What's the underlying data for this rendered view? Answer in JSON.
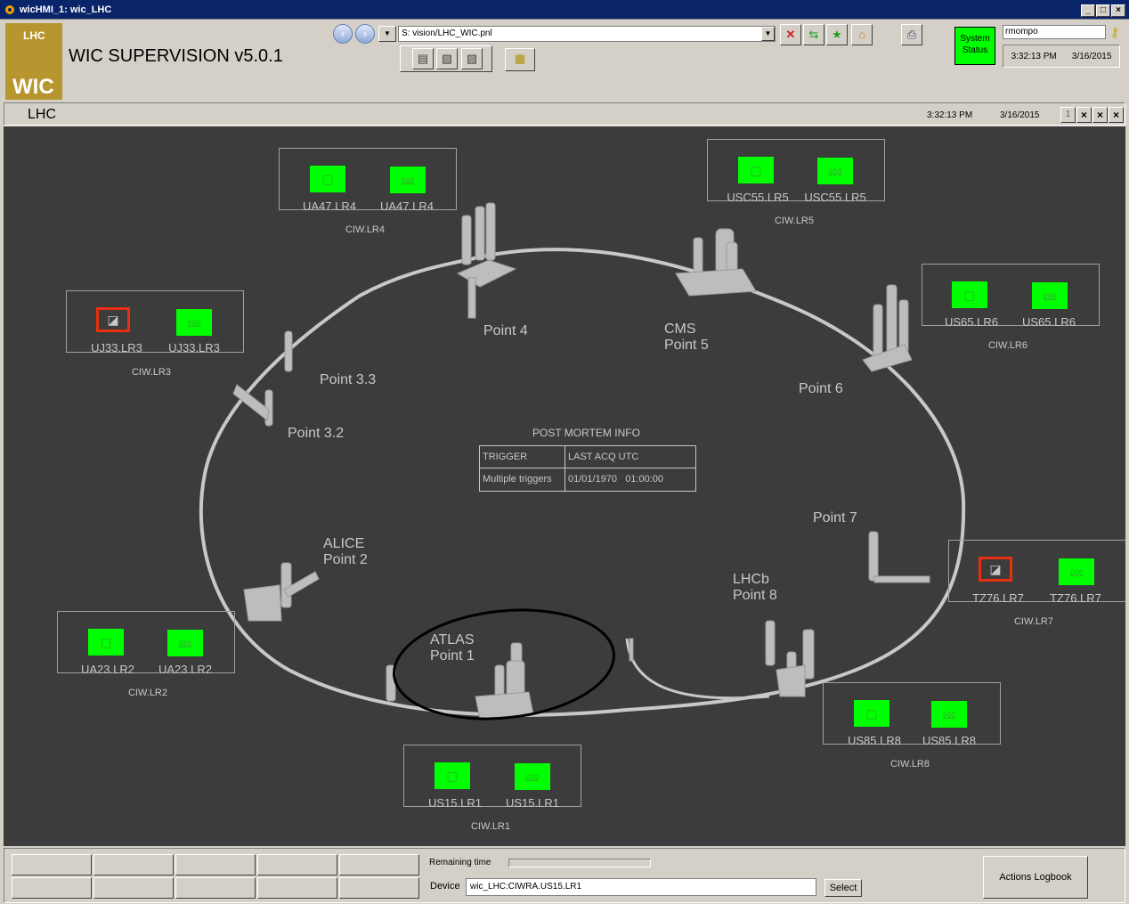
{
  "window": {
    "title": "wicHMI_1: wic_LHC"
  },
  "app": {
    "logo_top": "LHC",
    "logo_bottom": "WIC",
    "title": "WIC SUPERVISION v5.0.1"
  },
  "toolbar": {
    "path": "S: vision/LHC_WIC.pnl"
  },
  "status": {
    "system_status": "System Status",
    "user": "rmompo",
    "time": "3:32:13 PM",
    "date": "3/16/2015"
  },
  "panel": {
    "name": "LHC",
    "time": "3:32:13 PM",
    "date": "3/16/2015",
    "page": "1"
  },
  "sectors": [
    {
      "cab1": "UA47.LR4",
      "cab2": "UA47.LR4",
      "ciw": "CIW.LR4",
      "fault1": false
    },
    {
      "cab1": "USC55.LR5",
      "cab2": "USC55.LR5",
      "ciw": "CIW.LR5",
      "fault1": false
    },
    {
      "cab1": "UJ33.LR3",
      "cab2": "UJ33.LR3",
      "ciw": "CIW.LR3",
      "fault1": true
    },
    {
      "cab1": "US65.LR6",
      "cab2": "US65.LR6",
      "ciw": "CIW.LR6",
      "fault1": false
    },
    {
      "cab1": "TZ76.LR7",
      "cab2": "TZ76.LR7",
      "ciw": "CIW.LR7",
      "fault1": true
    },
    {
      "cab1": "UA23.LR2",
      "cab2": "UA23.LR2",
      "ciw": "CIW.LR2",
      "fault1": false
    },
    {
      "cab1": "US85.LR8",
      "cab2": "US85.LR8",
      "ciw": "CIW.LR8",
      "fault1": false
    },
    {
      "cab1": "US15.LR1",
      "cab2": "US15.LR1",
      "ciw": "CIW.LR1",
      "fault1": false
    }
  ],
  "points": {
    "p4": "Point 4",
    "p5a": "CMS",
    "p5b": "Point 5",
    "p6": "Point 6",
    "p33": "Point 3.3",
    "p32": "Point 3.2",
    "p7": "Point 7",
    "p2a": "ALICE",
    "p2b": "Point 2",
    "p8a": "LHCb",
    "p8b": "Point 8",
    "p1a": "ATLAS",
    "p1b": "Point 1"
  },
  "post_mortem": {
    "title": "POST MORTEM INFO",
    "headers": [
      "TRIGGER",
      "LAST ACQ UTC"
    ],
    "row": [
      "Multiple triggers",
      "01/01/1970   01:00:00"
    ]
  },
  "bottom": {
    "remaining_label": "Remaining time",
    "remaining_fraction": 0,
    "device_label": "Device",
    "device_value": "wic_LHC:CIWRA.US15.LR1",
    "select_label": "Select",
    "logbook_label": "Actions Logbook"
  },
  "colors": {
    "ok": "#00ff00",
    "fault": "#e83010",
    "background": "#3c3c3c"
  }
}
